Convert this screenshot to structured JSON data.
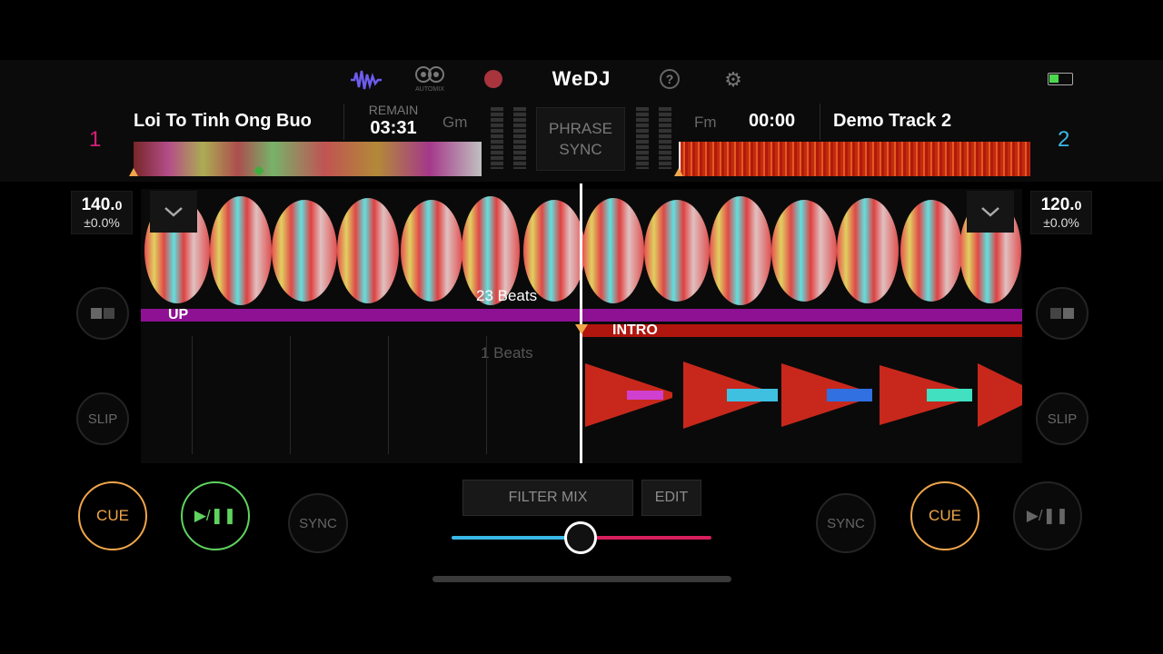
{
  "app": {
    "name": "WeDJ"
  },
  "header": {
    "automix_label": "AUTOMIX",
    "waveform_icon": "waveform-icon",
    "record_icon": "record-icon",
    "help_icon": "help-icon",
    "settings_icon": "gear-icon",
    "battery_icon": "battery-icon"
  },
  "deck1": {
    "number": "1",
    "title": "Loi To Tinh Ong Buo",
    "remain_label": "REMAIN",
    "remain": "03:31",
    "key": "Gm",
    "bpm_int": "140.",
    "bpm_dec": "0",
    "pitch": "±0.0%",
    "phrase": "UP",
    "beats": "23 Beats",
    "cue": "CUE",
    "play": "▶/❚❚",
    "sync": "SYNC",
    "slip": "SLIP",
    "accent": "#d61f7a"
  },
  "deck2": {
    "number": "2",
    "title": "Demo Track 2",
    "time": "00:00",
    "key": "Fm",
    "bpm_int": "120.",
    "bpm_dec": "0",
    "pitch": "±0.0%",
    "phrase": "INTRO",
    "beats": "1 Beats",
    "cue": "CUE",
    "play": "▶/❚❚",
    "sync": "SYNC",
    "slip": "SLIP",
    "accent": "#3ab8e8"
  },
  "center": {
    "phrase_sync_line1": "PHRASE",
    "phrase_sync_line2": "SYNC",
    "filter_mix": "FILTER MIX",
    "edit": "EDIT",
    "crossfader_position": 0.5
  },
  "colors": {
    "cue": "#f0a64a",
    "play_active": "#5fd35f",
    "phrase_up": "#8e1193",
    "phrase_intro": "#b0160e",
    "fader_left": "#3ab8e8",
    "fader_right": "#d61f5c"
  }
}
